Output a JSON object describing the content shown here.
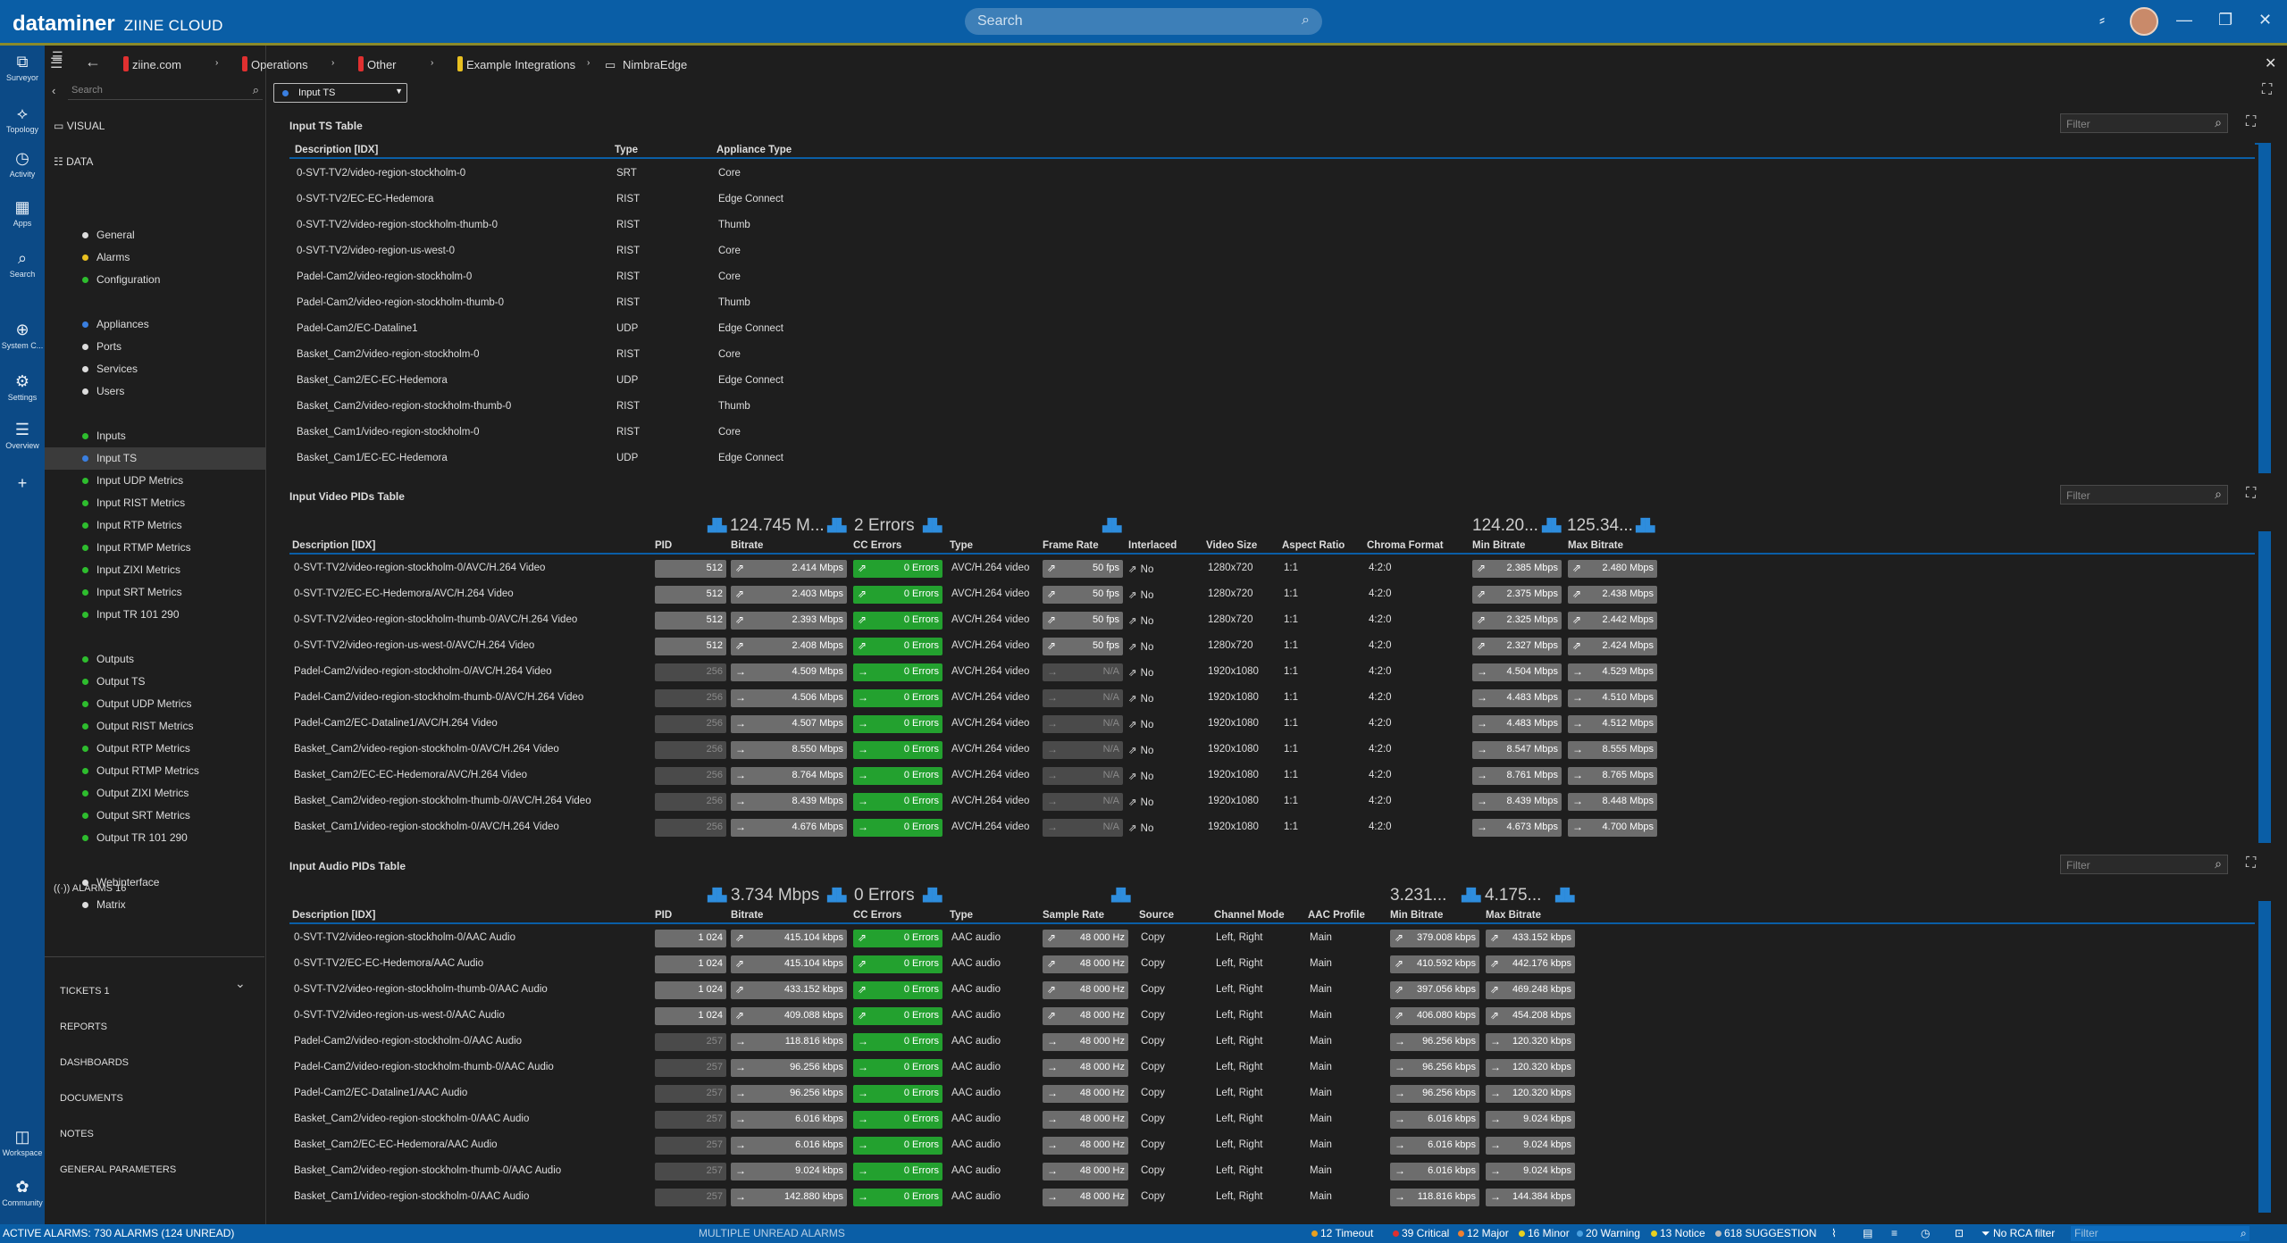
{
  "app": {
    "brand": "dataminer",
    "subbrand": "ZIINE CLOUD",
    "search_placeholder": "Search"
  },
  "leftbar": [
    {
      "label": "Surveyor",
      "icon": "surveyor-icon",
      "g": "⧉"
    },
    {
      "label": "Topology",
      "icon": "topology-icon",
      "g": "⟡"
    },
    {
      "label": "Activity",
      "icon": "activity-icon",
      "g": "◷"
    },
    {
      "label": "Apps",
      "icon": "apps-icon",
      "g": "▦"
    },
    {
      "label": "Search",
      "icon": "search-icon",
      "g": "⌕"
    },
    {
      "label": "System C...",
      "icon": "globe-icon",
      "g": "⊕"
    },
    {
      "label": "Settings",
      "icon": "settings-icon",
      "g": "⚙"
    },
    {
      "label": "Overview",
      "icon": "overview-icon",
      "g": "☰"
    },
    {
      "label": "",
      "icon": "add-icon",
      "g": "+"
    },
    {
      "label": "Workspace",
      "icon": "workspace-icon",
      "g": "◫"
    },
    {
      "label": "Community",
      "icon": "community-icon",
      "g": "✿"
    }
  ],
  "breadcrumb": [
    {
      "label": "ziine.com",
      "color": "#e03030"
    },
    {
      "label": "Operations",
      "color": "#e03030"
    },
    {
      "label": "Other",
      "color": "#e03030"
    },
    {
      "label": "Example Integrations",
      "color": "#e8c020"
    },
    {
      "label": "NimbraEdge",
      "color": ""
    }
  ],
  "nav": {
    "search_placeholder": "Search",
    "visual": "VISUAL",
    "data": "DATA",
    "items": [
      {
        "label": "General",
        "color": "#dddddd",
        "sel": false
      },
      {
        "label": "Alarms",
        "color": "#e8c020",
        "sel": false
      },
      {
        "label": "Configuration",
        "color": "#2ebd2e",
        "sel": false
      },
      {
        "label": "Appliances",
        "color": "#3a7fe0",
        "sel": false
      },
      {
        "label": "Ports",
        "color": "#dddddd",
        "sel": false
      },
      {
        "label": "Services",
        "color": "#dddddd",
        "sel": false
      },
      {
        "label": "Users",
        "color": "#dddddd",
        "sel": false
      },
      {
        "label": "Inputs",
        "color": "#2ebd2e",
        "sel": false
      },
      {
        "label": "Input TS",
        "color": "#3a7fe0",
        "sel": true
      },
      {
        "label": "Input UDP Metrics",
        "color": "#2ebd2e",
        "sel": false
      },
      {
        "label": "Input RIST Metrics",
        "color": "#2ebd2e",
        "sel": false
      },
      {
        "label": "Input RTP Metrics",
        "color": "#2ebd2e",
        "sel": false
      },
      {
        "label": "Input RTMP Metrics",
        "color": "#2ebd2e",
        "sel": false
      },
      {
        "label": "Input ZIXI Metrics",
        "color": "#2ebd2e",
        "sel": false
      },
      {
        "label": "Input SRT Metrics",
        "color": "#2ebd2e",
        "sel": false
      },
      {
        "label": "Input TR 101 290",
        "color": "#2ebd2e",
        "sel": false
      },
      {
        "label": "Outputs",
        "color": "#2ebd2e",
        "sel": false
      },
      {
        "label": "Output TS",
        "color": "#2ebd2e",
        "sel": false
      },
      {
        "label": "Output UDP Metrics",
        "color": "#2ebd2e",
        "sel": false
      },
      {
        "label": "Output RIST Metrics",
        "color": "#2ebd2e",
        "sel": false
      },
      {
        "label": "Output RTP Metrics",
        "color": "#2ebd2e",
        "sel": false
      },
      {
        "label": "Output RTMP Metrics",
        "color": "#2ebd2e",
        "sel": false
      },
      {
        "label": "Output ZIXI Metrics",
        "color": "#2ebd2e",
        "sel": false
      },
      {
        "label": "Output SRT Metrics",
        "color": "#2ebd2e",
        "sel": false
      },
      {
        "label": "Output TR 101 290",
        "color": "#2ebd2e",
        "sel": false
      },
      {
        "label": "Webinterface",
        "color": "#dddddd",
        "sel": false
      },
      {
        "label": "Matrix",
        "color": "#dddddd",
        "sel": false
      }
    ],
    "alarms": "ALARMS 16",
    "bottom": [
      "TICKETS 1",
      "REPORTS",
      "DASHBOARDS",
      "DOCUMENTS",
      "NOTES",
      "GENERAL PARAMETERS"
    ]
  },
  "page_selector": "Input TS",
  "filter_placeholder": "Filter",
  "ts_table": {
    "title": "Input TS Table",
    "headers": [
      "Description [IDX]",
      "Type",
      "Appliance Type"
    ],
    "rows": [
      [
        "0-SVT-TV2/video-region-stockholm-0",
        "SRT",
        "Core"
      ],
      [
        "0-SVT-TV2/EC-EC-Hedemora",
        "RIST",
        "Edge Connect"
      ],
      [
        "0-SVT-TV2/video-region-stockholm-thumb-0",
        "RIST",
        "Thumb"
      ],
      [
        "0-SVT-TV2/video-region-us-west-0",
        "RIST",
        "Core"
      ],
      [
        "Padel-Cam2/video-region-stockholm-0",
        "RIST",
        "Core"
      ],
      [
        "Padel-Cam2/video-region-stockholm-thumb-0",
        "RIST",
        "Thumb"
      ],
      [
        "Padel-Cam2/EC-Dataline1",
        "UDP",
        "Edge Connect"
      ],
      [
        "Basket_Cam2/video-region-stockholm-0",
        "RIST",
        "Core"
      ],
      [
        "Basket_Cam2/EC-EC-Hedemora",
        "UDP",
        "Edge Connect"
      ],
      [
        "Basket_Cam2/video-region-stockholm-thumb-0",
        "RIST",
        "Thumb"
      ],
      [
        "Basket_Cam1/video-region-stockholm-0",
        "RIST",
        "Core"
      ],
      [
        "Basket_Cam1/EC-EC-Hedemora",
        "UDP",
        "Edge Connect"
      ]
    ]
  },
  "video_table": {
    "title": "Input Video PIDs Table",
    "summary": {
      "bitrate": "124.745 M...",
      "cc": "2 Errors",
      "min": "124.20...",
      "max": "125.34..."
    },
    "headers": [
      "Description [IDX]",
      "PID",
      "Bitrate",
      "CC Errors",
      "Type",
      "Frame Rate",
      "Interlaced",
      "Video Size",
      "Aspect Ratio",
      "Chroma Format",
      "Min Bitrate",
      "Max Bitrate"
    ],
    "rows": [
      {
        "d": "0-SVT-TV2/video-region-stockholm-0/AVC/H.264 Video",
        "pid": "512",
        "br": "2.414 Mbps",
        "cc": "0 Errors",
        "t": "AVC/H.264 video",
        "fr": "50 fps",
        "il": "No",
        "vs": "1280x720",
        "ar": "1:1",
        "cf": "4:2:0",
        "min": "2.385 Mbps",
        "max": "2.480 Mbps",
        "hp": true
      },
      {
        "d": "0-SVT-TV2/EC-EC-Hedemora/AVC/H.264 Video",
        "pid": "512",
        "br": "2.403 Mbps",
        "cc": "0 Errors",
        "t": "AVC/H.264 video",
        "fr": "50 fps",
        "il": "No",
        "vs": "1280x720",
        "ar": "1:1",
        "cf": "4:2:0",
        "min": "2.375 Mbps",
        "max": "2.438 Mbps",
        "hp": true
      },
      {
        "d": "0-SVT-TV2/video-region-stockholm-thumb-0/AVC/H.264 Video",
        "pid": "512",
        "br": "2.393 Mbps",
        "cc": "0 Errors",
        "t": "AVC/H.264 video",
        "fr": "50 fps",
        "il": "No",
        "vs": "1280x720",
        "ar": "1:1",
        "cf": "4:2:0",
        "min": "2.325 Mbps",
        "max": "2.442 Mbps",
        "hp": true
      },
      {
        "d": "0-SVT-TV2/video-region-us-west-0/AVC/H.264 Video",
        "pid": "512",
        "br": "2.408 Mbps",
        "cc": "0 Errors",
        "t": "AVC/H.264 video",
        "fr": "50 fps",
        "il": "No",
        "vs": "1280x720",
        "ar": "1:1",
        "cf": "4:2:0",
        "min": "2.327 Mbps",
        "max": "2.424 Mbps",
        "hp": true
      },
      {
        "d": "Padel-Cam2/video-region-stockholm-0/AVC/H.264 Video",
        "pid": "256",
        "br": "4.509 Mbps",
        "cc": "0 Errors",
        "t": "AVC/H.264 video",
        "fr": "N/A",
        "il": "No",
        "vs": "1920x1080",
        "ar": "1:1",
        "cf": "4:2:0",
        "min": "4.504 Mbps",
        "max": "4.529 Mbps",
        "hp": false
      },
      {
        "d": "Padel-Cam2/video-region-stockholm-thumb-0/AVC/H.264 Video",
        "pid": "256",
        "br": "4.506 Mbps",
        "cc": "0 Errors",
        "t": "AVC/H.264 video",
        "fr": "N/A",
        "il": "No",
        "vs": "1920x1080",
        "ar": "1:1",
        "cf": "4:2:0",
        "min": "4.483 Mbps",
        "max": "4.510 Mbps",
        "hp": false
      },
      {
        "d": "Padel-Cam2/EC-Dataline1/AVC/H.264 Video",
        "pid": "256",
        "br": "4.507 Mbps",
        "cc": "0 Errors",
        "t": "AVC/H.264 video",
        "fr": "N/A",
        "il": "No",
        "vs": "1920x1080",
        "ar": "1:1",
        "cf": "4:2:0",
        "min": "4.483 Mbps",
        "max": "4.512 Mbps",
        "hp": false
      },
      {
        "d": "Basket_Cam2/video-region-stockholm-0/AVC/H.264 Video",
        "pid": "256",
        "br": "8.550 Mbps",
        "cc": "0 Errors",
        "t": "AVC/H.264 video",
        "fr": "N/A",
        "il": "No",
        "vs": "1920x1080",
        "ar": "1:1",
        "cf": "4:2:0",
        "min": "8.547 Mbps",
        "max": "8.555 Mbps",
        "hp": false
      },
      {
        "d": "Basket_Cam2/EC-EC-Hedemora/AVC/H.264 Video",
        "pid": "256",
        "br": "8.764 Mbps",
        "cc": "0 Errors",
        "t": "AVC/H.264 video",
        "fr": "N/A",
        "il": "No",
        "vs": "1920x1080",
        "ar": "1:1",
        "cf": "4:2:0",
        "min": "8.761 Mbps",
        "max": "8.765 Mbps",
        "hp": false
      },
      {
        "d": "Basket_Cam2/video-region-stockholm-thumb-0/AVC/H.264 Video",
        "pid": "256",
        "br": "8.439 Mbps",
        "cc": "0 Errors",
        "t": "AVC/H.264 video",
        "fr": "N/A",
        "il": "No",
        "vs": "1920x1080",
        "ar": "1:1",
        "cf": "4:2:0",
        "min": "8.439 Mbps",
        "max": "8.448 Mbps",
        "hp": false
      },
      {
        "d": "Basket_Cam1/video-region-stockholm-0/AVC/H.264 Video",
        "pid": "256",
        "br": "4.676 Mbps",
        "cc": "0 Errors",
        "t": "AVC/H.264 video",
        "fr": "N/A",
        "il": "No",
        "vs": "1920x1080",
        "ar": "1:1",
        "cf": "4:2:0",
        "min": "4.673 Mbps",
        "max": "4.700 Mbps",
        "hp": false
      }
    ]
  },
  "audio_table": {
    "title": "Input Audio PIDs Table",
    "summary": {
      "bitrate": "3.734 Mbps",
      "cc": "0 Errors",
      "min": "3.231...",
      "max": "4.175..."
    },
    "headers": [
      "Description [IDX]",
      "PID",
      "Bitrate",
      "CC Errors",
      "Type",
      "Sample Rate",
      "Source",
      "Channel Mode",
      "AAC Profile",
      "Min Bitrate",
      "Max Bitrate"
    ],
    "rows": [
      {
        "d": "0-SVT-TV2/video-region-stockholm-0/AAC Audio",
        "pid": "1 024",
        "br": "415.104 kbps",
        "cc": "0 Errors",
        "t": "AAC audio",
        "sr": "48 000 Hz",
        "src": "Copy",
        "cm": "Left, Right",
        "ap": "Main",
        "min": "379.008 kbps",
        "max": "433.152 kbps",
        "hp": true
      },
      {
        "d": "0-SVT-TV2/EC-EC-Hedemora/AAC Audio",
        "pid": "1 024",
        "br": "415.104 kbps",
        "cc": "0 Errors",
        "t": "AAC audio",
        "sr": "48 000 Hz",
        "src": "Copy",
        "cm": "Left, Right",
        "ap": "Main",
        "min": "410.592 kbps",
        "max": "442.176 kbps",
        "hp": true
      },
      {
        "d": "0-SVT-TV2/video-region-stockholm-thumb-0/AAC Audio",
        "pid": "1 024",
        "br": "433.152 kbps",
        "cc": "0 Errors",
        "t": "AAC audio",
        "sr": "48 000 Hz",
        "src": "Copy",
        "cm": "Left, Right",
        "ap": "Main",
        "min": "397.056 kbps",
        "max": "469.248 kbps",
        "hp": true
      },
      {
        "d": "0-SVT-TV2/video-region-us-west-0/AAC Audio",
        "pid": "1 024",
        "br": "409.088 kbps",
        "cc": "0 Errors",
        "t": "AAC audio",
        "sr": "48 000 Hz",
        "src": "Copy",
        "cm": "Left, Right",
        "ap": "Main",
        "min": "406.080 kbps",
        "max": "454.208 kbps",
        "hp": true
      },
      {
        "d": "Padel-Cam2/video-region-stockholm-0/AAC Audio",
        "pid": "257",
        "br": "118.816 kbps",
        "cc": "0 Errors",
        "t": "AAC audio",
        "sr": "48 000 Hz",
        "src": "Copy",
        "cm": "Left, Right",
        "ap": "Main",
        "min": "96.256 kbps",
        "max": "120.320 kbps",
        "hp": false
      },
      {
        "d": "Padel-Cam2/video-region-stockholm-thumb-0/AAC Audio",
        "pid": "257",
        "br": "96.256 kbps",
        "cc": "0 Errors",
        "t": "AAC audio",
        "sr": "48 000 Hz",
        "src": "Copy",
        "cm": "Left, Right",
        "ap": "Main",
        "min": "96.256 kbps",
        "max": "120.320 kbps",
        "hp": false
      },
      {
        "d": "Padel-Cam2/EC-Dataline1/AAC Audio",
        "pid": "257",
        "br": "96.256 kbps",
        "cc": "0 Errors",
        "t": "AAC audio",
        "sr": "48 000 Hz",
        "src": "Copy",
        "cm": "Left, Right",
        "ap": "Main",
        "min": "96.256 kbps",
        "max": "120.320 kbps",
        "hp": false
      },
      {
        "d": "Basket_Cam2/video-region-stockholm-0/AAC Audio",
        "pid": "257",
        "br": "6.016 kbps",
        "cc": "0 Errors",
        "t": "AAC audio",
        "sr": "48 000 Hz",
        "src": "Copy",
        "cm": "Left, Right",
        "ap": "Main",
        "min": "6.016 kbps",
        "max": "9.024 kbps",
        "hp": false
      },
      {
        "d": "Basket_Cam2/EC-EC-Hedemora/AAC Audio",
        "pid": "257",
        "br": "6.016 kbps",
        "cc": "0 Errors",
        "t": "AAC audio",
        "sr": "48 000 Hz",
        "src": "Copy",
        "cm": "Left, Right",
        "ap": "Main",
        "min": "6.016 kbps",
        "max": "9.024 kbps",
        "hp": false
      },
      {
        "d": "Basket_Cam2/video-region-stockholm-thumb-0/AAC Audio",
        "pid": "257",
        "br": "9.024 kbps",
        "cc": "0 Errors",
        "t": "AAC audio",
        "sr": "48 000 Hz",
        "src": "Copy",
        "cm": "Left, Right",
        "ap": "Main",
        "min": "6.016 kbps",
        "max": "9.024 kbps",
        "hp": false
      },
      {
        "d": "Basket_Cam1/video-region-stockholm-0/AAC Audio",
        "pid": "257",
        "br": "142.880 kbps",
        "cc": "0 Errors",
        "t": "AAC audio",
        "sr": "48 000 Hz",
        "src": "Copy",
        "cm": "Left, Right",
        "ap": "Main",
        "min": "118.816 kbps",
        "max": "144.384 kbps",
        "hp": false
      }
    ]
  },
  "status": {
    "active": "ACTIVE ALARMS: 730 ALARMS (124 UNREAD)",
    "multi": "MULTIPLE UNREAD ALARMS",
    "counts": [
      {
        "label": "12 Timeout",
        "color": "#e8a020"
      },
      {
        "label": "39 Critical",
        "color": "#e03030"
      },
      {
        "label": "12 Major",
        "color": "#f08030"
      },
      {
        "label": "16 Minor",
        "color": "#e8d020"
      },
      {
        "label": "20 Warning",
        "color": "#4aa0e0"
      },
      {
        "label": "13 Notice",
        "color": "#e8d020"
      },
      {
        "label": "618 SUGGESTION",
        "color": "#bbbbbb"
      }
    ],
    "rca": "No RCA filter",
    "filter_placeholder": "Filter"
  }
}
